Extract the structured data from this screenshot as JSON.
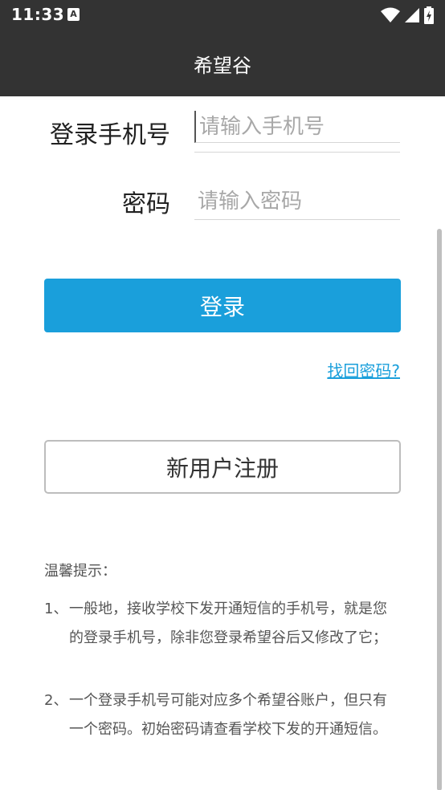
{
  "status": {
    "time": "11:33",
    "notification_glyph": "A"
  },
  "app_bar": {
    "title": "希望谷"
  },
  "form": {
    "phone_label": "登录手机号",
    "phone_placeholder": "请输入手机号",
    "password_label": "密码",
    "password_placeholder": "请输入密码"
  },
  "actions": {
    "login_label": "登录",
    "forgot_label": "找回密码?",
    "register_label": "新用户注册"
  },
  "tips": {
    "title": "温馨提示：",
    "items": [
      {
        "num": "1、",
        "text": "一般地，接收学校下发开通短信的手机号，就是您的登录手机号，除非您登录希望谷后又修改了它；"
      },
      {
        "num": "2、",
        "text": "一个登录手机号可能对应多个希望谷账户，但只有一个密码。初始密码请查看学校下发的开通短信。"
      }
    ]
  },
  "colors": {
    "app_bar": "#333333",
    "accent": "#1a9fdb",
    "text": "#212121",
    "muted_text": "#555555",
    "placeholder": "#a8a8a8"
  },
  "icons": [
    "wifi-icon",
    "cell-signal-icon",
    "battery-charging-icon"
  ]
}
